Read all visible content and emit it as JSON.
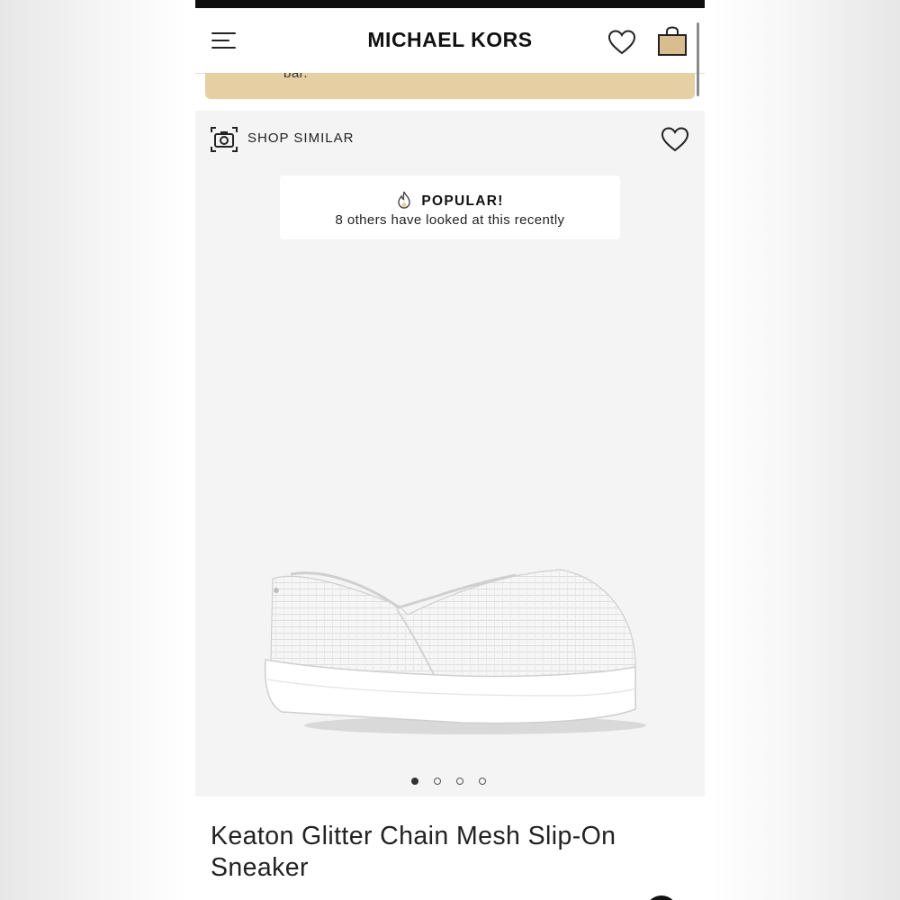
{
  "header": {
    "brand": "MICHAEL KORS",
    "menu_icon": "hamburger-menu-icon",
    "wishlist_icon": "heart-icon",
    "bag_icon": "shopping-bag-icon"
  },
  "banner": {
    "text": "bar."
  },
  "gallery": {
    "shop_similar_label": "SHOP SIMILAR",
    "camera_icon": "camera-icon",
    "wishlist_icon": "heart-icon",
    "popular_title": "POPULAR!",
    "popular_icon": "flame-icon",
    "popular_subtitle": "8 others have looked at this recently",
    "image_count": 4,
    "active_image": 1
  },
  "product": {
    "title": "Keaton Glitter Chain Mesh Slip-On Sneaker"
  },
  "colors": {
    "banner_bg": "#e6cfa2",
    "bag_fill": "#d9bd8e",
    "gallery_bg": "#f4f4f4",
    "text": "#222222"
  }
}
